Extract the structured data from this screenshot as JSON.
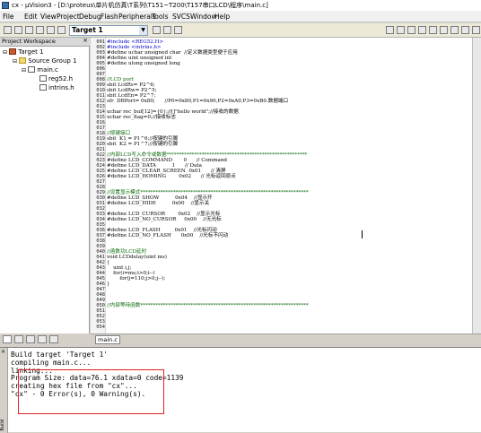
{
  "window": {
    "title": "cx - µVision3 - [D:\\proteus\\单片机仿真\\T系列\\T151~T200\\T157串口LCD\\程序\\main.c]"
  },
  "menu": [
    "File",
    "Edit",
    "View",
    "Project",
    "Debug",
    "Flash",
    "Peripherals",
    "Tools",
    "SVCS",
    "Window",
    "Help"
  ],
  "toolbar": {
    "target": "Target 1"
  },
  "workspace": {
    "title": "Project Workspace",
    "close": "×",
    "tree": {
      "target": "Target 1",
      "group": "Source Group 1",
      "file": "main.c",
      "includes": [
        "reg52.h",
        "intrins.h"
      ]
    }
  },
  "editor": {
    "line_numbers": "001\n002\n003\n004\n005\n006\n007\n008\n009\n010\n011\n012\n013\n014\n015\n016\n017\n018\n019\n020\n021\n022\n023\n024\n025\n026\n027\n028\n029\n030\n031\n032\n033\n034\n035\n036\n037\n038\n039\n040\n041\n042\n043\n044\n045\n046\n047\n048\n049\n050\n051\n052\n053\n054",
    "lines": [
      {
        "t": "#include <REG52.H>",
        "c": "kw"
      },
      {
        "t": "#include <intrins.h>",
        "c": "kw"
      },
      {
        "t": "#define uchar unsigned char  //定义数据类型便于应用",
        "c": ""
      },
      {
        "t": "#define uint unsigned int",
        "c": ""
      },
      {
        "t": "#define ulong unsigned long",
        "c": ""
      },
      {
        "t": "",
        "c": ""
      },
      {
        "t": "",
        "c": ""
      },
      {
        "t": "//LCD port",
        "c": "cm"
      },
      {
        "t": "sbit LcdRs= P2^6;",
        "c": ""
      },
      {
        "t": "sbit LcdRw= P2^5;",
        "c": ""
      },
      {
        "t": "sbit LcdEn= P2^7;",
        "c": ""
      },
      {
        "t": "sfr  DBPort= 0x80;      //P0=0x80,P1=0x90,P2=0xA0,P3=0xB0.数据端口",
        "c": ""
      },
      {
        "t": "",
        "c": ""
      },
      {
        "t": "uchar rec_buf[12]={0};//[]\"hello world\";//接收的数据",
        "c": ""
      },
      {
        "t": "uchar rec_flag=0;//接收标志",
        "c": ""
      },
      {
        "t": "",
        "c": ""
      },
      {
        "t": "",
        "c": ""
      },
      {
        "t": "//按键接口",
        "c": "cm"
      },
      {
        "t": "sbit  K1 = P1^6;//按键的引脚",
        "c": ""
      },
      {
        "t": "sbit  K2 = P1^7;//按键的引脚",
        "c": ""
      },
      {
        "t": "",
        "c": ""
      },
      {
        "t": "//内部LCD写入命令或数据********************************************************",
        "c": "cm"
      },
      {
        "t": "#define LCD_COMMAND       0      // Command",
        "c": ""
      },
      {
        "t": "#define LCD_DATA          1      // Data",
        "c": ""
      },
      {
        "t": "#define LCD_CLEAR_SCREEN  0x01      // 清屏",
        "c": ""
      },
      {
        "t": "#define LCD_HOMING        0x02      // 光标返回原点",
        "c": ""
      },
      {
        "t": "",
        "c": ""
      },
      {
        "t": "",
        "c": ""
      },
      {
        "t": "//设置显示模式*******************************************************************",
        "c": "cm"
      },
      {
        "t": "#define LCD_SHOW          0x04    //显示开",
        "c": ""
      },
      {
        "t": "#define LCD_HIDE          0x00    //显示关",
        "c": ""
      },
      {
        "t": "",
        "c": ""
      },
      {
        "t": "#define LCD_CURSOR        0x02    //显示光标",
        "c": ""
      },
      {
        "t": "#define LCD_NO_CURSOR     0x00    //无光标",
        "c": ""
      },
      {
        "t": "",
        "c": ""
      },
      {
        "t": "#define LCD_FLASH         0x01    //光标闪动",
        "c": ""
      },
      {
        "t": "#define LCD_NO_FLASH      0x00    //光标不闪动",
        "c": ""
      },
      {
        "t": "",
        "c": ""
      },
      {
        "t": "",
        "c": ""
      },
      {
        "t": "//函数功LCD延时",
        "c": "cm"
      },
      {
        "t": "void LCDdelay(uint ms)",
        "c": ""
      },
      {
        "t": "{",
        "c": ""
      },
      {
        "t": "    uint i,j;",
        "c": ""
      },
      {
        "t": "    for(i=ms;i>0;i--)",
        "c": ""
      },
      {
        "t": "        for(j=110;j>0;j--);",
        "c": ""
      },
      {
        "t": "}",
        "c": ""
      },
      {
        "t": "",
        "c": ""
      },
      {
        "t": "",
        "c": ""
      },
      {
        "t": "",
        "c": ""
      },
      {
        "t": "//内部等待函数*******************************************************************",
        "c": "cm"
      }
    ]
  },
  "editor_tab": "main.c",
  "build": {
    "side_label": "Build",
    "close": "×",
    "output": "Build target 'Target 1'\ncompiling main.c...\nlinking...\nProgram Size: data=76.1 xdata=0 code=1139\ncreating hex file from \"cx\"...\n\"cx\" - 0 Error(s), 0 Warning(s)."
  },
  "colors": {
    "highlight_box": "#e02020",
    "comment": "#0a6a0a",
    "keyword": "#0000c8"
  }
}
